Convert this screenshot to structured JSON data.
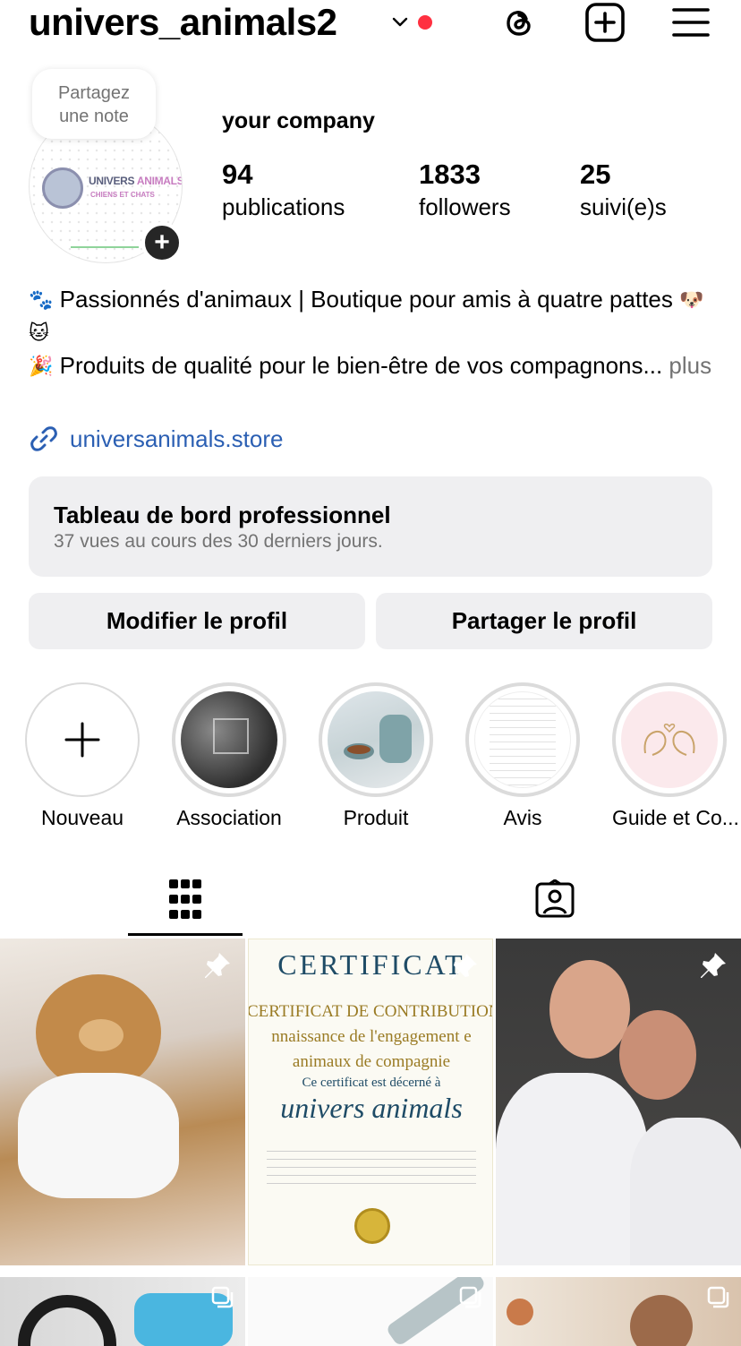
{
  "header": {
    "username": "univers_animals2",
    "icons": [
      "chevron-down-icon",
      "threads-icon",
      "create-icon",
      "menu-icon"
    ]
  },
  "note": {
    "line1": "Partagez",
    "line2": "une note"
  },
  "avatar": {
    "logo_text_1": "UNIVERS",
    "logo_text_1b": "ANIMALS",
    "logo_text_2": "CHIENS ET CHATS",
    "badge": "+"
  },
  "profile": {
    "name": "your company",
    "stats": [
      {
        "value": "94",
        "label": "publications"
      },
      {
        "value": "1833",
        "label": "followers"
      },
      {
        "value": "25",
        "label": "suivi(e)s"
      }
    ]
  },
  "bio": {
    "emoji1": "🐾",
    "line1": "Passionnés d'animaux | Boutique pour amis à quatre pattes",
    "emoji2": "🐶",
    "emoji3": "🐱",
    "emoji4": "🎉",
    "line2": "Produits de qualité pour le bien-être de vos compagnons...",
    "more": "plus",
    "link": "universanimals.store"
  },
  "dashboard": {
    "title": "Tableau de bord professionnel",
    "subtitle": "37 vues au cours des 30 derniers jours."
  },
  "buttons": {
    "edit": "Modifier le profil",
    "share": "Partager le profil"
  },
  "highlights": [
    {
      "label": "Nouveau"
    },
    {
      "label": "Association"
    },
    {
      "label": "Produit"
    },
    {
      "label": "Avis"
    },
    {
      "label": "Guide et Co..."
    }
  ],
  "posts": {
    "certificate": {
      "heading": "CERTIFICAT",
      "line1": "CERTIFICAT DE CONTRIBUTION",
      "line2": "nnaissance de l'engagement e",
      "line3": "animaux de compagnie",
      "line4": "Ce certificat est décerné à",
      "brand": "univers animals"
    }
  },
  "colors": {
    "accent_link": "#2b5fb3",
    "notification_dot": "#ff3040",
    "button_bg": "#efeff1"
  }
}
